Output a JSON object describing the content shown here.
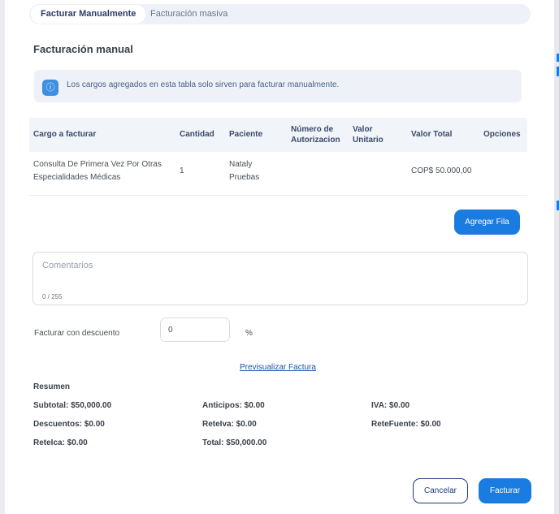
{
  "tabs": [
    {
      "label": "Facturar Manualmente",
      "active": true
    },
    {
      "label": "Facturación masiva",
      "active": false
    }
  ],
  "section_title": "Facturación manual",
  "info_banner": {
    "icon": "info-icon",
    "text": "Los cargos agregados en esta tabla solo sirven para facturar manualmente."
  },
  "table": {
    "headers": {
      "charge": "Cargo a facturar",
      "quantity": "Cantidad",
      "patient": "Paciente",
      "auth_line1": "Número de",
      "auth_line2": "Autorizacion",
      "unit_line1": "Valor",
      "unit_line2": "Unitario",
      "total": "Valor Total",
      "options": "Opciones"
    },
    "rows": [
      {
        "charge_line1": "Consulta De Primera Vez Por Otras",
        "charge_line2": "Especialidades Médicas",
        "quantity": "1",
        "patient_line1": "Nataly",
        "patient_line2": "Pruebas",
        "authorization": "",
        "unit_value": "",
        "total": "COP$ 50.000,00"
      }
    ]
  },
  "add_row_label": "Agregar Fila",
  "comments": {
    "placeholder": "Comentarios",
    "counter": "0 / 255"
  },
  "discount": {
    "label": "Facturar con descuento",
    "value": "0",
    "unit": "%"
  },
  "preview_link": "Previsualizar Factura",
  "summary": {
    "title": "Resumen",
    "subtotal": "Subtotal: $50,000.00",
    "advances": "Anticipos: $0.00",
    "iva": "IVA: $0.00",
    "discounts": "Descuentos: $0.00",
    "reteiva": "ReteIva: $0.00",
    "retefuente": "ReteFuente: $0.00",
    "reteica": "ReteIca: $0.00",
    "total": "Total: $50,000.00"
  },
  "footer": {
    "cancel_label": "Cancelar",
    "submit_label": "Facturar"
  },
  "colors": {
    "primary": "#1a7be0",
    "navy": "#1f3c7a",
    "tab_bg": "#eef2f8"
  }
}
